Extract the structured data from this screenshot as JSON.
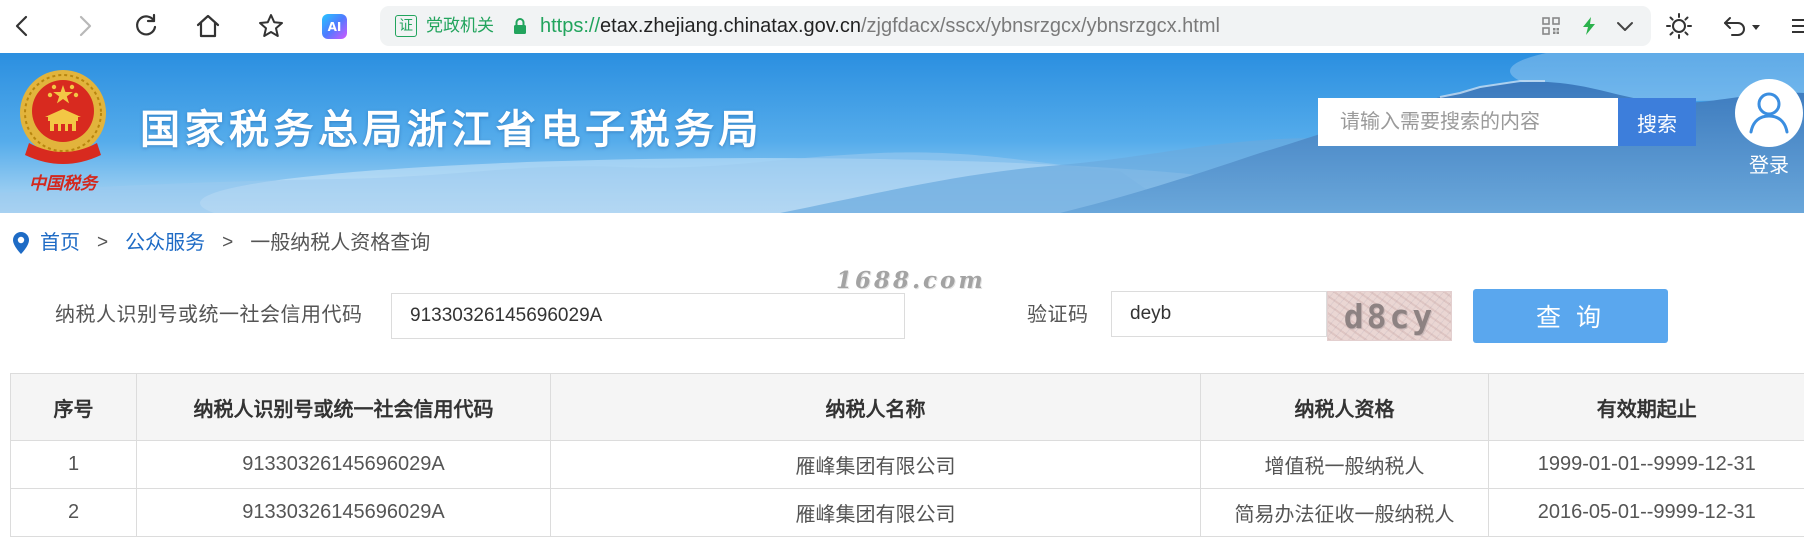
{
  "browser": {
    "url_badge": "证",
    "url_badge_label": "党政机关",
    "url_scheme": "https://",
    "url_host": "etax.zhejiang.chinatax.gov.cn",
    "url_path": "/zjgfdacx/sscx/ybnsrzgcx/ybnsrzgcx.html",
    "ai_badge": "AI",
    "icons": [
      "back-arrow-icon",
      "forward-arrow-icon",
      "refresh-icon",
      "home-icon",
      "star-icon",
      "ai-assistant-icon",
      "lock-icon",
      "qr-code-icon",
      "lightning-icon",
      "chevron-down-icon",
      "brightness-icon",
      "undo-icon",
      "menu-icon"
    ]
  },
  "header": {
    "emblem_lettering": "中国税务",
    "title": "国家税务总局浙江省电子税务局",
    "search": {
      "placeholder": "请输入需要搜索的内容",
      "button": "搜索"
    },
    "login_label": "登录"
  },
  "breadcrumb": {
    "separator": ">",
    "items": [
      "首页",
      "公众服务",
      "一般纳税人资格查询"
    ]
  },
  "watermark": "1688.com",
  "query_form": {
    "taxpayer_id": {
      "label": "纳税人识别号或统一社会信用代码",
      "value": "91330326145696029A"
    },
    "captcha": {
      "label": "验证码",
      "value": "deyb",
      "image_text": "d8cy"
    },
    "submit_label": "查 询"
  },
  "results": {
    "columns": [
      "序号",
      "纳税人识别号或统一社会信用代码",
      "纳税人名称",
      "纳税人资格",
      "有效期起止"
    ],
    "rows": [
      [
        "1",
        "91330326145696029A",
        "雁峰集团有限公司",
        "增值税一般纳税人",
        "1999-01-01--9999-12-31"
      ],
      [
        "2",
        "91330326145696029A",
        "雁峰集团有限公司",
        "简易办法征收一般纳税人",
        "2016-05-01--9999-12-31"
      ]
    ]
  },
  "theme": {
    "accent": "#3d7edb",
    "link": "#1e6bc5",
    "query_button": "#5aa7ee",
    "secure_green": "#22a45d",
    "table_header_bg": "#f5f5f5"
  }
}
